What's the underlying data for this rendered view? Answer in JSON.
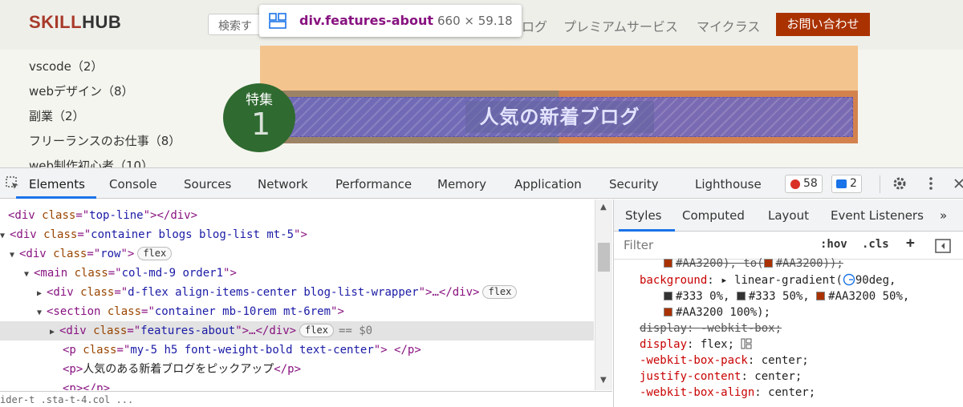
{
  "site": {
    "logo_part1": "SKILL",
    "logo_part2": "HUB",
    "search_placeholder": "検索す",
    "nav": [
      "ログ",
      "プレミアムサービス",
      "マイクラス"
    ],
    "contact_button": "お問い合わせ",
    "categories": [
      "vscode（2）",
      "webデザイン（8）",
      "副業（2）",
      "フリーランスのお仕事（8）",
      "web制作初心者（10）"
    ],
    "feature_badge_label": "特集",
    "feature_badge_number": "1",
    "feature_title": "人気の新着ブログ"
  },
  "tooltip": {
    "element_name": "div.features-about",
    "size": "660 × 59.18"
  },
  "devtools": {
    "tabs": [
      "Elements",
      "Console",
      "Sources",
      "Network",
      "Performance",
      "Memory",
      "Application",
      "Security",
      "Lighthouse"
    ],
    "errors_count": "58",
    "messages_count": "2",
    "more_label": "»",
    "elements": {
      "line1": {
        "tag_open": "<div ",
        "attr": "class",
        "eq": "=\"",
        "val": "top-line",
        "close": "\"></div>"
      },
      "line2": {
        "tag_open": "<div ",
        "attr": "class",
        "eq": "=\"",
        "val": "container blogs blog-list mt-5",
        "close": "\">"
      },
      "line3": {
        "tag_open": "<div ",
        "attr": "class",
        "eq": "=\"",
        "val": "row",
        "close": "\">",
        "pill": "flex"
      },
      "line4": {
        "tag_open": "<main ",
        "attr": "class",
        "eq": "=\"",
        "val": "col-md-9 order1",
        "close": "\">"
      },
      "line5": {
        "tag_open": "<div ",
        "attr": "class",
        "eq": "=\"",
        "val": "d-flex align-items-center blog-list-wrapper",
        "close": "\">…</div>",
        "pill": "flex"
      },
      "line6": {
        "tag_open": "<section ",
        "attr": "class",
        "eq": "=\"",
        "val": "container mb-10rem mt-6rem",
        "close": "\">"
      },
      "line7": {
        "tag_open": "<div ",
        "attr": "class",
        "eq": "=\"",
        "val": "features-about",
        "close": "\">…</div>",
        "pill": "flex",
        "dollar": "== $0"
      },
      "line8": {
        "tag_open": "<p ",
        "attr": "class",
        "eq": "=\"",
        "val": "my-5 h5 font-weight-bold text-center",
        "close": "\"> </p>"
      },
      "line9": {
        "tag_open": "<p>",
        "text": "人気のある新着ブログをピックアップ",
        "close": "</p>"
      },
      "line10": {
        "text": "<p></p>"
      }
    },
    "breadcrumb": "ider-t  .sta-t-4.col  ...",
    "styles": {
      "tabs": [
        "Styles",
        "Computed",
        "Layout",
        "Event Listeners"
      ],
      "more": "»",
      "filter_placeholder": "Filter",
      "hov": ":hov",
      "cls": ".cls",
      "plus": "+",
      "css": {
        "l0": "#AA3200), to(",
        "l0b": "#AA3200));",
        "l1_prop": "background",
        "l1_val": "linear-gradient(",
        "l1_val2": "90deg,",
        "l2a": "#333 0%,",
        "l2b": "#333 50%,",
        "l2c": "#AA3200 50%,",
        "l3": "#AA3200 100%);",
        "l4_prop": "display",
        "l4_val": "-webkit-box;",
        "l5_prop": "display",
        "l5_val": "flex;",
        "l6_prop": "-webkit-box-pack",
        "l6_val": "center;",
        "l7_prop": "justify-content",
        "l7_val": "center;",
        "l8_prop": "-webkit-box-align",
        "l8_val": "center;"
      }
    }
  },
  "colors": {
    "accent": "#aa3200",
    "dark": "#333333",
    "devtools_blue": "#1a73e8"
  }
}
